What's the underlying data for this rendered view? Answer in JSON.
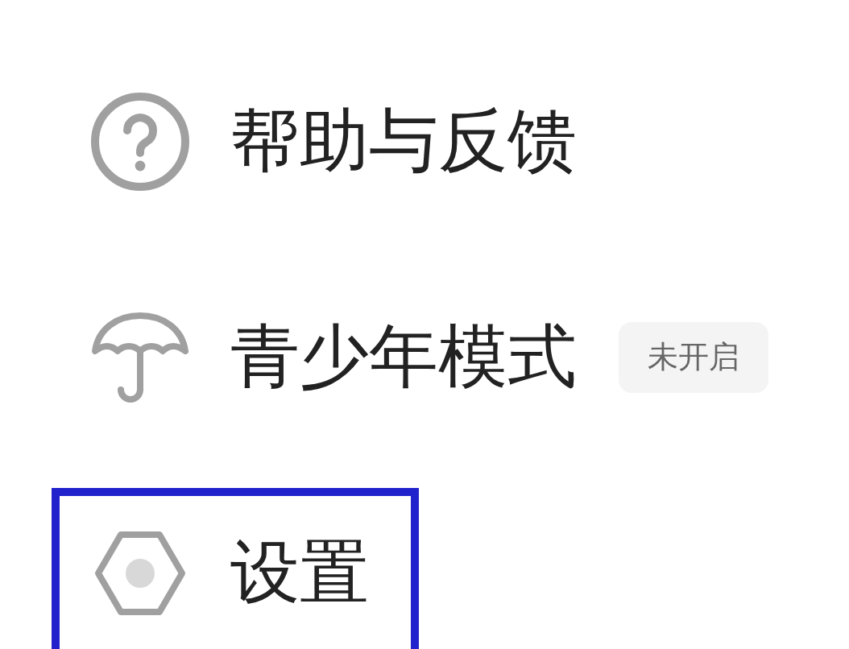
{
  "menu_items": [
    {
      "label": "帮助与反馈",
      "highlighted": false
    },
    {
      "label": "青少年模式",
      "badge": "未开启",
      "highlighted": false
    },
    {
      "label": "设置",
      "highlighted": true
    }
  ]
}
